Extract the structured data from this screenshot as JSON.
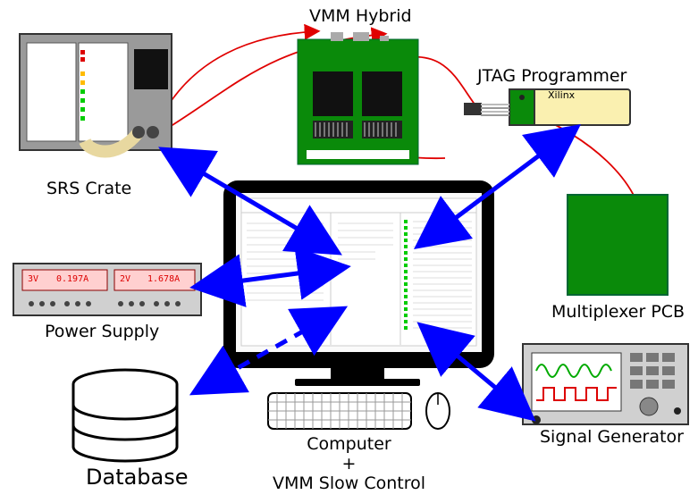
{
  "diagram": {
    "srs_crate": {
      "label": "SRS Crate"
    },
    "power_supply": {
      "label": "Power Supply",
      "display1_v": "3V",
      "display1_a": "0.197A",
      "display2_v": "2V",
      "display2_a": "1.678A"
    },
    "database": {
      "label": "Database"
    },
    "vmm_hybrid": {
      "label": "VMM Hybrid"
    },
    "computer": {
      "label_line1": "Computer",
      "label_line2": "+",
      "label_line3": "VMM Slow Control"
    },
    "jtag": {
      "label": "JTAG Programmer",
      "chip_label": "Xilinx"
    },
    "multiplexer": {
      "label": "Multiplexer PCB"
    },
    "signal_generator": {
      "label": "Signal Generator"
    }
  }
}
